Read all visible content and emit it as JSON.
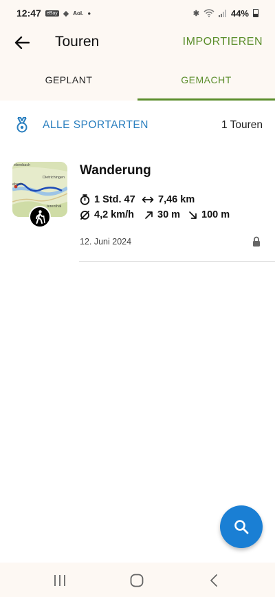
{
  "status_bar": {
    "time": "12:47",
    "battery": "44%",
    "app_icons": [
      "eBay",
      "gecko",
      "Aol."
    ]
  },
  "header": {
    "title": "Touren",
    "import_label": "IMPORTIEREN"
  },
  "tabs": [
    {
      "label": "GEPLANT",
      "active": false
    },
    {
      "label": "GEMACHT",
      "active": true
    }
  ],
  "filter": {
    "label": "ALLE SPORTARTEN",
    "count": "1 Touren"
  },
  "tours": [
    {
      "name": "Wanderung",
      "duration": "1 Std. 47",
      "distance": "7,46 km",
      "avg_speed": "4,2 km/h",
      "ascent": "30 m",
      "descent": "100 m",
      "date": "12. Juni 2024",
      "sport": "hiking",
      "map_labels": [
        "ebenbach",
        "Dietrichingen",
        "ebach",
        "terenthal"
      ]
    }
  ],
  "colors": {
    "accent_green": "#5a8d2a",
    "accent_blue": "#2a7fbf",
    "fab_blue": "#1a7fd4",
    "bar_background": "#fdf8f3"
  }
}
